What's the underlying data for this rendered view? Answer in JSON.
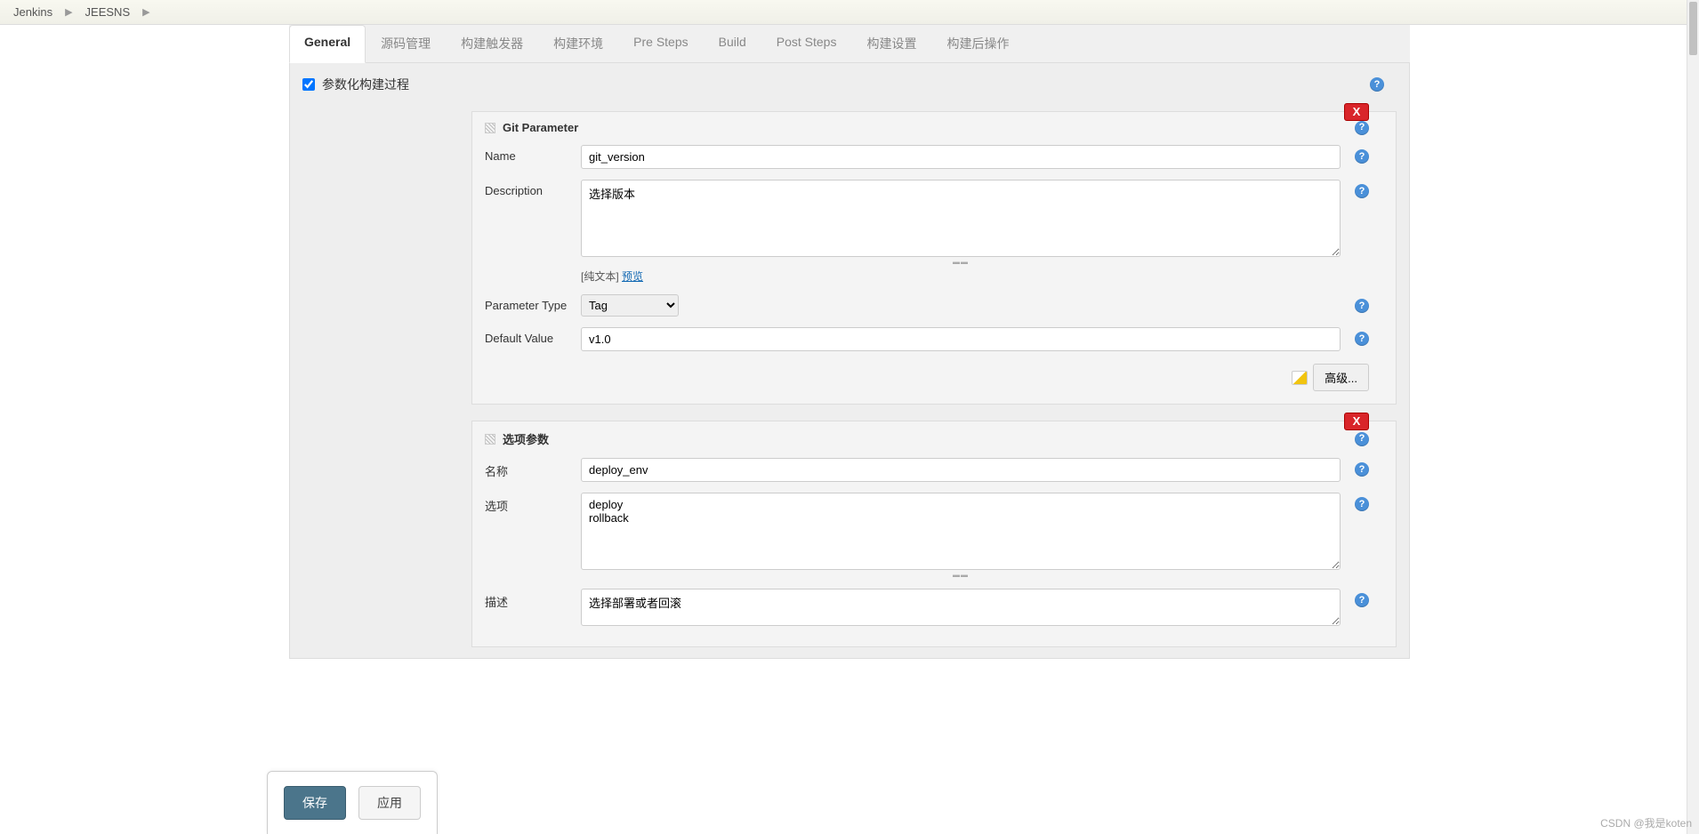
{
  "breadcrumb": {
    "items": [
      "Jenkins",
      "JEESNS"
    ]
  },
  "tabs": [
    "General",
    "源码管理",
    "构建触发器",
    "构建环境",
    "Pre Steps",
    "Build",
    "Post Steps",
    "构建设置",
    "构建后操作"
  ],
  "param_build": {
    "label": "参数化构建过程",
    "checked": true
  },
  "git_param": {
    "title": "Git Parameter",
    "delete": "X",
    "name_label": "Name",
    "name_value": "git_version",
    "desc_label": "Description",
    "desc_value": "选择版本",
    "desc_hint_prefix": "[纯文本] ",
    "desc_hint_link": "预览",
    "type_label": "Parameter Type",
    "type_value": "Tag",
    "default_label": "Default Value",
    "default_value": "v1.0",
    "advanced": "高级..."
  },
  "choice_param": {
    "title": "选项参数",
    "delete": "X",
    "name_label": "名称",
    "name_value": "deploy_env",
    "choices_label": "选项",
    "choices_value": "deploy\nrollback",
    "desc_label": "描述",
    "desc_value": "选择部署或者回滚"
  },
  "buttons": {
    "save": "保存",
    "apply": "应用"
  },
  "watermark": "CSDN @我是koten"
}
